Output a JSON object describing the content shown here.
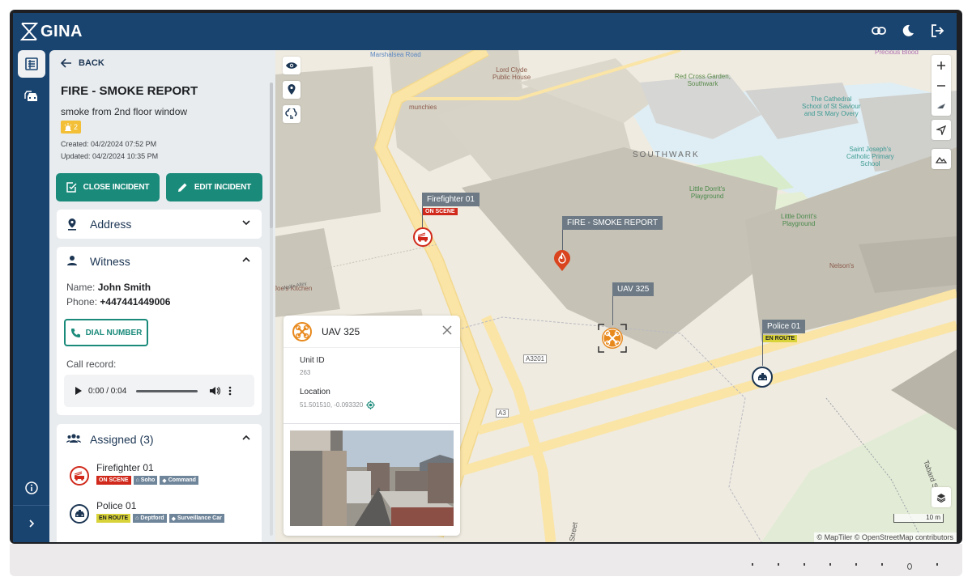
{
  "app": {
    "name": "GINA",
    "top_icons": [
      "link-icon",
      "dark-mode-icon",
      "logout-icon"
    ]
  },
  "rail": {
    "items": [
      {
        "icon": "incident-list-icon",
        "active": true
      },
      {
        "icon": "vehicles-icon",
        "active": false
      }
    ],
    "bottom": [
      {
        "icon": "info-icon"
      },
      {
        "icon": "expand-chevron-icon"
      }
    ]
  },
  "incident": {
    "back_label": "BACK",
    "title": "FIRE - SMOKE REPORT",
    "description": "smoke from 2nd floor window",
    "priority": "2",
    "created": "Created: 04/2/2024 07:52 PM",
    "updated": "Updated: 04/2/2024 10:35 PM",
    "close_label": "CLOSE INCIDENT",
    "edit_label": "EDIT INCIDENT"
  },
  "address": {
    "title": "Address",
    "expanded": false
  },
  "witness": {
    "title": "Witness",
    "name_label": "Name:",
    "name": "John Smith",
    "phone_label": "Phone:",
    "phone": "+447441449006",
    "dial_label": "DIAL NUMBER",
    "call_record_label": "Call record:",
    "audio_time": "0:00 / 0:04",
    "audio_progress": 0
  },
  "assigned": {
    "title": "Assigned (3)",
    "units": [
      {
        "name": "Firefighter 01",
        "type": "fire",
        "status": "ON SCENE",
        "station": "Soho",
        "role": "Command"
      },
      {
        "name": "Police 01",
        "type": "police",
        "status": "EN ROUTE",
        "station": "Deptford",
        "role": "Surveillance Car"
      }
    ]
  },
  "map": {
    "tool_buttons": [
      "visibility-icon",
      "location-pin-icon",
      "weather-icon"
    ],
    "controls": [
      "zoom-in",
      "zoom-out",
      "compass",
      "locate",
      "terrain"
    ],
    "district_label": "SOUTHWARK",
    "markers": [
      {
        "label": "Firefighter 01",
        "status": "ON SCENE",
        "kind": "fire-unit"
      },
      {
        "label": "FIRE - SMOKE REPORT",
        "kind": "incident"
      },
      {
        "label": "UAV 325",
        "kind": "uav"
      },
      {
        "label": "Police 01",
        "status": "EN ROUTE",
        "kind": "police-unit"
      }
    ],
    "places": {
      "marshalsea": "Marshalsea Road",
      "lord_clyde": "Lord Clyde\nPublic House",
      "munchies": "munchies",
      "red_cross": "Red Cross Garden,\nSouthwark",
      "cathedral_school": "The Cathedral\nSchool of St Saviour\nand St Mary Overy",
      "st_josephs": "Saint Joseph's\nCatholic Primary\nSchool",
      "dorrit1": "Little Dorrit's\nPlayground",
      "dorrit2": "Little Dorrit's\nPlayground",
      "nelsons": "Nelson's",
      "joes": "Joe's Kitchen",
      "precious_blood": "Precious Blood",
      "a3201": "A3201",
      "a3": "A3",
      "street": "Street",
      "tabard": "Tabard St",
      "wallis_alley": "Wallis Alley"
    },
    "popup": {
      "title": "UAV 325",
      "unit_id_label": "Unit ID",
      "unit_id": "263",
      "location_label": "Location",
      "location": "51.501510, -0.093320"
    },
    "scale_label": "10 m",
    "attribution": "© MapTiler © OpenStreetMap contributors"
  },
  "colors": {
    "brand": "#1a4470",
    "primary_action": "#1a8a7a",
    "on_scene": "#d0291b",
    "en_route": "#d9d33a",
    "uav": "#e8891d",
    "incident": "#d9441f"
  }
}
